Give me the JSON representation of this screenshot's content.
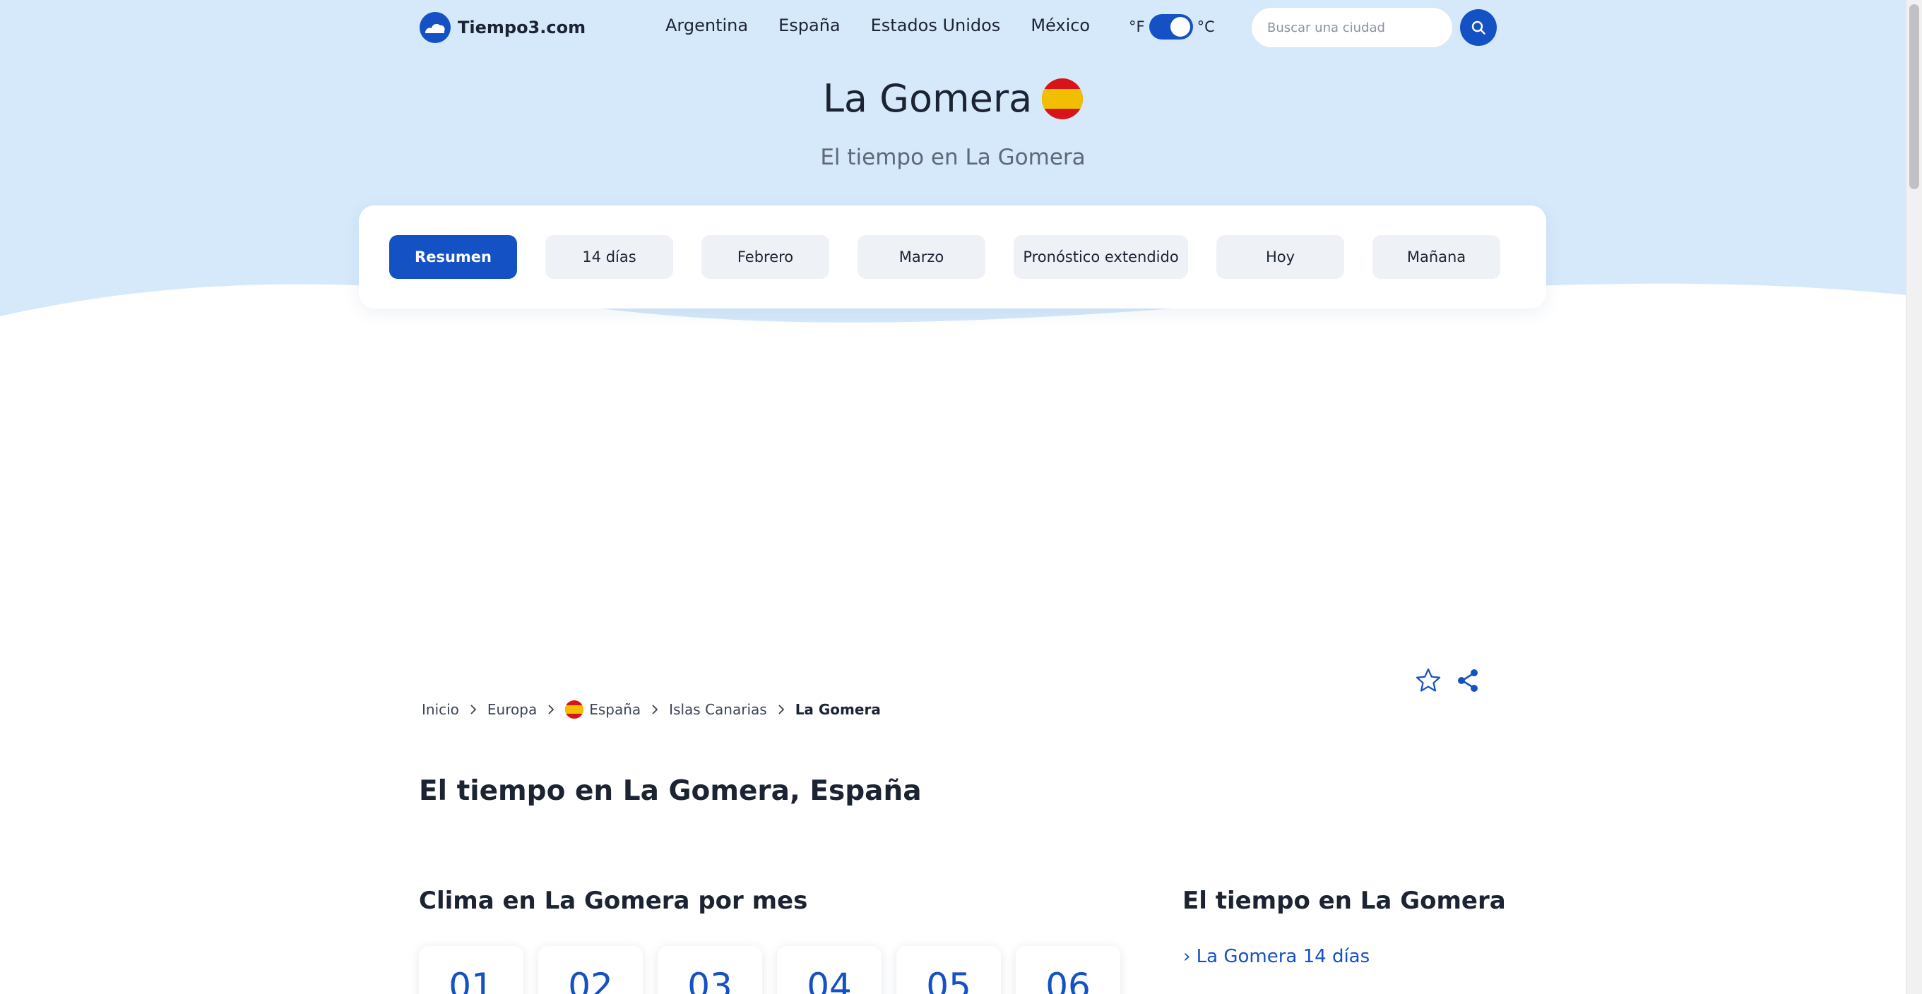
{
  "brand": {
    "name": "Tiempo3.com",
    "colors": {
      "primary": "#1451c4",
      "hero": "#d6e9fb"
    }
  },
  "nav": [
    {
      "label": "Argentina"
    },
    {
      "label": "España"
    },
    {
      "label": "Estados Unidos"
    },
    {
      "label": "México"
    }
  ],
  "units": {
    "fahrenheit": "°F",
    "celsius": "°C",
    "selected": "°C"
  },
  "search": {
    "placeholder": "Buscar una ciudad",
    "value": "",
    "icon": "search-icon"
  },
  "hero": {
    "title": "La Gomera",
    "flag": "spain-flag",
    "subtitle": "El tiempo en La Gomera"
  },
  "tabs": [
    {
      "label": "Resumen",
      "active": true
    },
    {
      "label": "14 días"
    },
    {
      "label": "Febrero"
    },
    {
      "label": "Marzo"
    },
    {
      "label": "Pronóstico extendido"
    },
    {
      "label": "Hoy"
    },
    {
      "label": "Mañana"
    }
  ],
  "breadcrumb": [
    {
      "label": "Inicio"
    },
    {
      "label": "Europa"
    },
    {
      "label": "España",
      "icon": "spain-flag"
    },
    {
      "label": "Islas Canarias"
    },
    {
      "label": "La Gomera",
      "current": true
    }
  ],
  "actions": {
    "favorite_icon": "star-icon",
    "share_icon": "share-icon"
  },
  "main": {
    "heading": "El tiempo en La Gomera, España",
    "months_heading": "Clima en La Gomera por mes",
    "months": [
      "01",
      "02",
      "03",
      "04",
      "05",
      "06"
    ]
  },
  "sidebar": {
    "heading": "El tiempo en La Gomera",
    "links": [
      {
        "label": "› La Gomera 14 días"
      }
    ]
  }
}
